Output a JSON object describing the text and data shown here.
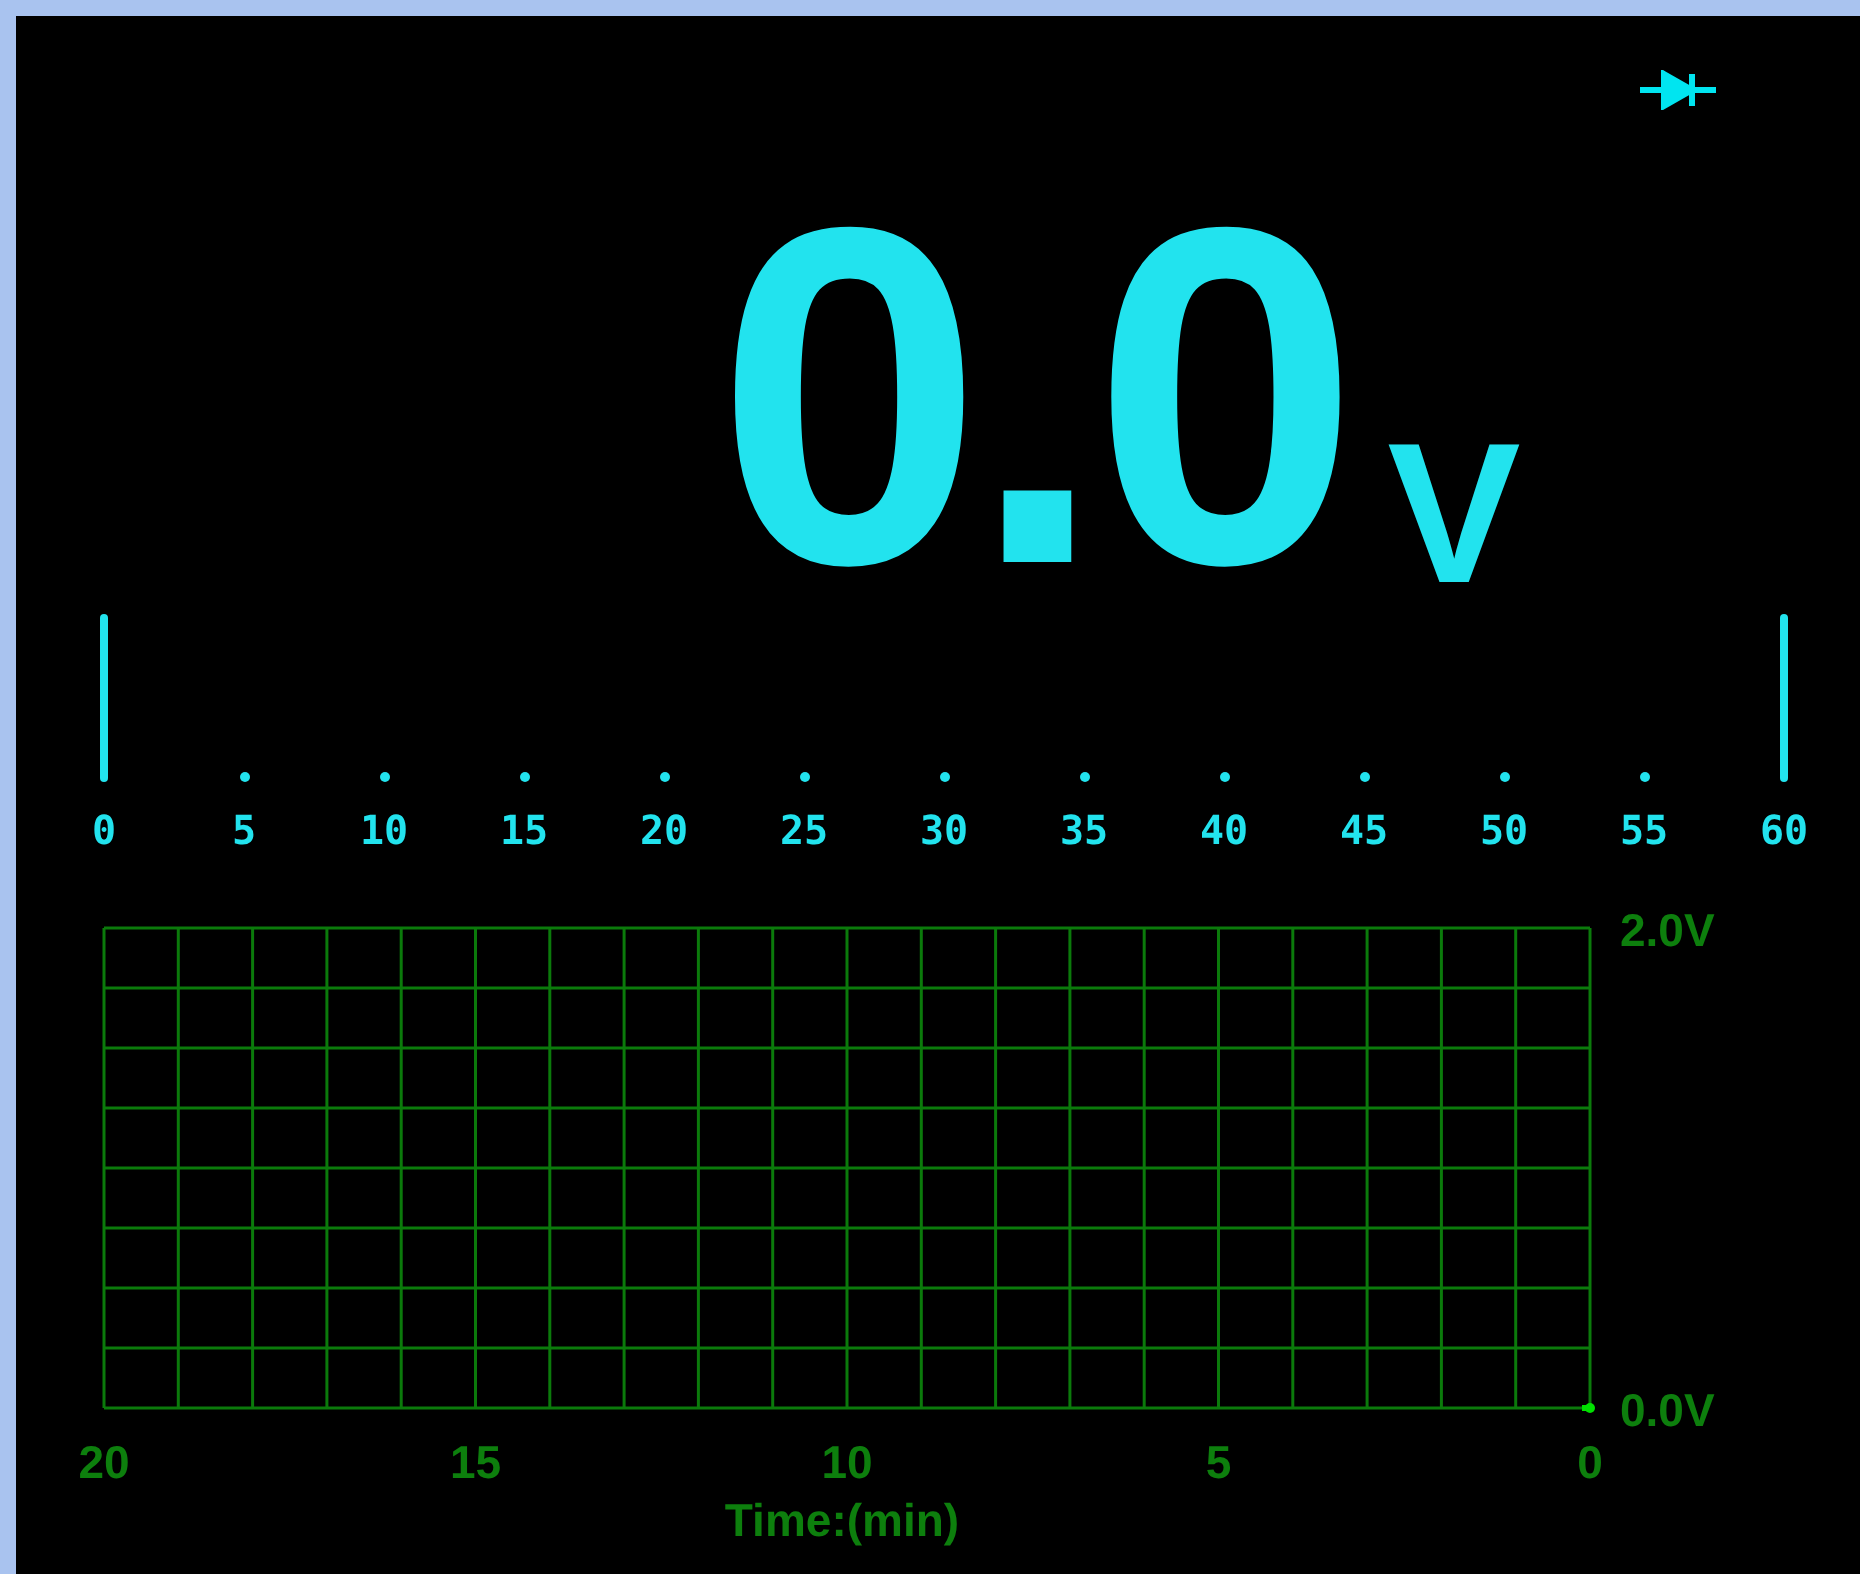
{
  "mode": {
    "kind": "diode"
  },
  "reading": {
    "value": "0.0",
    "unit": "V"
  },
  "bar_graph": {
    "scale": [
      {
        "label": "0",
        "kind": "major"
      },
      {
        "label": "5",
        "kind": "minor"
      },
      {
        "label": "10",
        "kind": "minor"
      },
      {
        "label": "15",
        "kind": "minor"
      },
      {
        "label": "20",
        "kind": "minor"
      },
      {
        "label": "25",
        "kind": "minor"
      },
      {
        "label": "30",
        "kind": "minor"
      },
      {
        "label": "35",
        "kind": "minor"
      },
      {
        "label": "40",
        "kind": "minor"
      },
      {
        "label": "45",
        "kind": "minor"
      },
      {
        "label": "50",
        "kind": "minor"
      },
      {
        "label": "55",
        "kind": "minor"
      },
      {
        "label": "60",
        "kind": "major"
      }
    ]
  },
  "trend": {
    "chart_data": {
      "type": "line",
      "grid": true,
      "xlabel": "Time:(min)",
      "xlim": [
        20,
        0
      ],
      "ylim": [
        0,
        2
      ],
      "xticks": [
        20,
        15,
        10,
        5,
        0
      ],
      "yticks": [
        {
          "value": 2,
          "label": "2.0V"
        },
        {
          "value": 0,
          "label": "0.0V"
        }
      ],
      "x": [
        0
      ],
      "series": [
        {
          "color": "#00e000",
          "marker": "circle",
          "values": [
            0
          ]
        }
      ]
    }
  }
}
